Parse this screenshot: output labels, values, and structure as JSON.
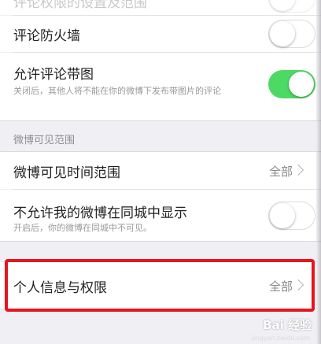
{
  "top_row": {
    "title": "评论权限的设置及范围"
  },
  "rows": {
    "comment_firewall": {
      "title": "评论防火墙",
      "toggle": "off"
    },
    "allow_image_comments": {
      "title": "允许评论带图",
      "subtitle": "关闭后，其他人将不能在你的微博下发布带图片的评论",
      "toggle": "on"
    }
  },
  "section_weibo_visibility": {
    "header": "微博可见范围"
  },
  "visibility_rows": {
    "time_range": {
      "title": "微博可见时间范围",
      "value": "全部"
    },
    "hide_in_local": {
      "title": "不允许我的微博在同城中显示",
      "subtitle": "开启后，你的微博在同城中不可见。",
      "toggle": "off"
    }
  },
  "personal_info": {
    "title": "个人信息与权限",
    "value": "全部"
  },
  "watermark": {
    "text": "Bai 经验",
    "sub": "jingyan.baidu.com"
  },
  "colors": {
    "toggle_on": "#4cd964",
    "highlight": "#e8141e",
    "background": "#efeff4"
  }
}
